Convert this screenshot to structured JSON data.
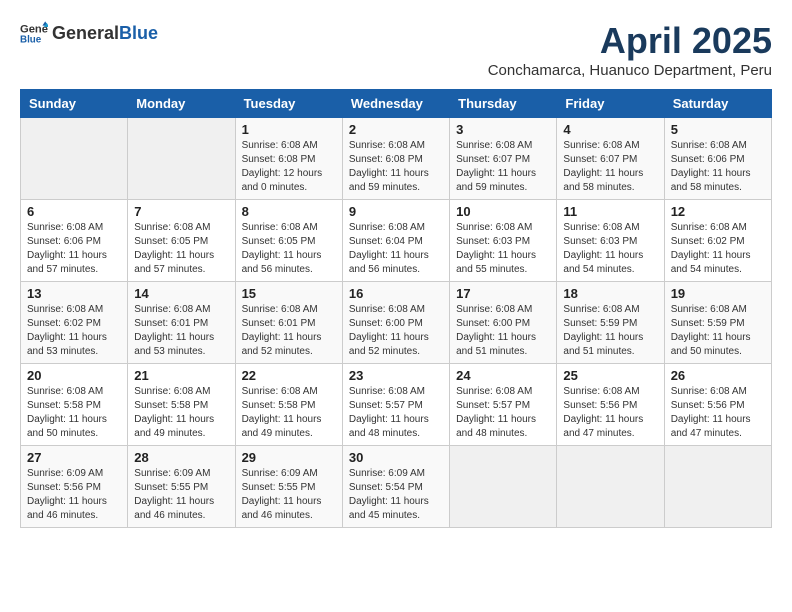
{
  "header": {
    "logo_general": "General",
    "logo_blue": "Blue",
    "title": "April 2025",
    "subtitle": "Conchamarca, Huanuco Department, Peru"
  },
  "calendar": {
    "days_of_week": [
      "Sunday",
      "Monday",
      "Tuesday",
      "Wednesday",
      "Thursday",
      "Friday",
      "Saturday"
    ],
    "weeks": [
      [
        {
          "day": "",
          "info": ""
        },
        {
          "day": "",
          "info": ""
        },
        {
          "day": "1",
          "info": "Sunrise: 6:08 AM\nSunset: 6:08 PM\nDaylight: 12 hours\nand 0 minutes."
        },
        {
          "day": "2",
          "info": "Sunrise: 6:08 AM\nSunset: 6:08 PM\nDaylight: 11 hours\nand 59 minutes."
        },
        {
          "day": "3",
          "info": "Sunrise: 6:08 AM\nSunset: 6:07 PM\nDaylight: 11 hours\nand 59 minutes."
        },
        {
          "day": "4",
          "info": "Sunrise: 6:08 AM\nSunset: 6:07 PM\nDaylight: 11 hours\nand 58 minutes."
        },
        {
          "day": "5",
          "info": "Sunrise: 6:08 AM\nSunset: 6:06 PM\nDaylight: 11 hours\nand 58 minutes."
        }
      ],
      [
        {
          "day": "6",
          "info": "Sunrise: 6:08 AM\nSunset: 6:06 PM\nDaylight: 11 hours\nand 57 minutes."
        },
        {
          "day": "7",
          "info": "Sunrise: 6:08 AM\nSunset: 6:05 PM\nDaylight: 11 hours\nand 57 minutes."
        },
        {
          "day": "8",
          "info": "Sunrise: 6:08 AM\nSunset: 6:05 PM\nDaylight: 11 hours\nand 56 minutes."
        },
        {
          "day": "9",
          "info": "Sunrise: 6:08 AM\nSunset: 6:04 PM\nDaylight: 11 hours\nand 56 minutes."
        },
        {
          "day": "10",
          "info": "Sunrise: 6:08 AM\nSunset: 6:03 PM\nDaylight: 11 hours\nand 55 minutes."
        },
        {
          "day": "11",
          "info": "Sunrise: 6:08 AM\nSunset: 6:03 PM\nDaylight: 11 hours\nand 54 minutes."
        },
        {
          "day": "12",
          "info": "Sunrise: 6:08 AM\nSunset: 6:02 PM\nDaylight: 11 hours\nand 54 minutes."
        }
      ],
      [
        {
          "day": "13",
          "info": "Sunrise: 6:08 AM\nSunset: 6:02 PM\nDaylight: 11 hours\nand 53 minutes."
        },
        {
          "day": "14",
          "info": "Sunrise: 6:08 AM\nSunset: 6:01 PM\nDaylight: 11 hours\nand 53 minutes."
        },
        {
          "day": "15",
          "info": "Sunrise: 6:08 AM\nSunset: 6:01 PM\nDaylight: 11 hours\nand 52 minutes."
        },
        {
          "day": "16",
          "info": "Sunrise: 6:08 AM\nSunset: 6:00 PM\nDaylight: 11 hours\nand 52 minutes."
        },
        {
          "day": "17",
          "info": "Sunrise: 6:08 AM\nSunset: 6:00 PM\nDaylight: 11 hours\nand 51 minutes."
        },
        {
          "day": "18",
          "info": "Sunrise: 6:08 AM\nSunset: 5:59 PM\nDaylight: 11 hours\nand 51 minutes."
        },
        {
          "day": "19",
          "info": "Sunrise: 6:08 AM\nSunset: 5:59 PM\nDaylight: 11 hours\nand 50 minutes."
        }
      ],
      [
        {
          "day": "20",
          "info": "Sunrise: 6:08 AM\nSunset: 5:58 PM\nDaylight: 11 hours\nand 50 minutes."
        },
        {
          "day": "21",
          "info": "Sunrise: 6:08 AM\nSunset: 5:58 PM\nDaylight: 11 hours\nand 49 minutes."
        },
        {
          "day": "22",
          "info": "Sunrise: 6:08 AM\nSunset: 5:58 PM\nDaylight: 11 hours\nand 49 minutes."
        },
        {
          "day": "23",
          "info": "Sunrise: 6:08 AM\nSunset: 5:57 PM\nDaylight: 11 hours\nand 48 minutes."
        },
        {
          "day": "24",
          "info": "Sunrise: 6:08 AM\nSunset: 5:57 PM\nDaylight: 11 hours\nand 48 minutes."
        },
        {
          "day": "25",
          "info": "Sunrise: 6:08 AM\nSunset: 5:56 PM\nDaylight: 11 hours\nand 47 minutes."
        },
        {
          "day": "26",
          "info": "Sunrise: 6:08 AM\nSunset: 5:56 PM\nDaylight: 11 hours\nand 47 minutes."
        }
      ],
      [
        {
          "day": "27",
          "info": "Sunrise: 6:09 AM\nSunset: 5:56 PM\nDaylight: 11 hours\nand 46 minutes."
        },
        {
          "day": "28",
          "info": "Sunrise: 6:09 AM\nSunset: 5:55 PM\nDaylight: 11 hours\nand 46 minutes."
        },
        {
          "day": "29",
          "info": "Sunrise: 6:09 AM\nSunset: 5:55 PM\nDaylight: 11 hours\nand 46 minutes."
        },
        {
          "day": "30",
          "info": "Sunrise: 6:09 AM\nSunset: 5:54 PM\nDaylight: 11 hours\nand 45 minutes."
        },
        {
          "day": "",
          "info": ""
        },
        {
          "day": "",
          "info": ""
        },
        {
          "day": "",
          "info": ""
        }
      ]
    ]
  }
}
